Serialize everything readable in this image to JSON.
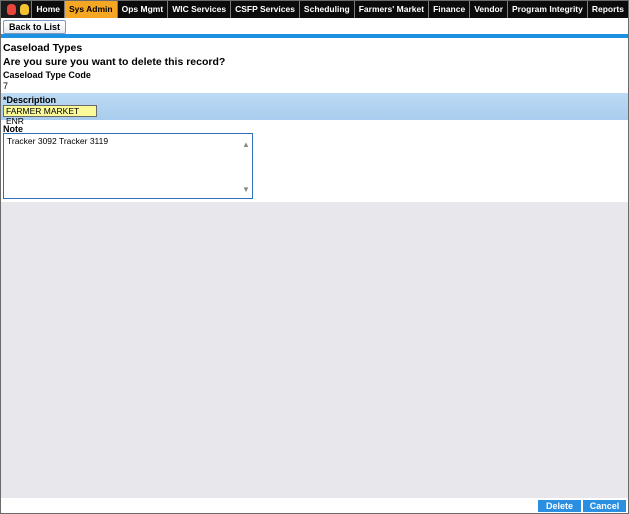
{
  "nav": {
    "items": [
      "Home",
      "Sys Admin",
      "Ops Mgmt",
      "WIC Services",
      "CSFP Services",
      "Scheduling",
      "Farmers' Market",
      "Finance",
      "Vendor",
      "Program Integrity",
      "Reports"
    ],
    "active": "Sys Admin",
    "active_color": "#f5a623"
  },
  "toolbar": {
    "back_label": "Back to List"
  },
  "page": {
    "title": "Caseload Types",
    "confirm": "Are you sure you want to delete this record?"
  },
  "fields": {
    "code_label": "Caseload Type Code",
    "code_value": "7",
    "description_label": "*Description",
    "description_value": "FARMER MARKET ENR",
    "note_label": "Note",
    "note_value": "Tracker 3092 Tracker 3119"
  },
  "footer": {
    "delete_label": "Delete",
    "cancel_label": "Cancel"
  },
  "colors": {
    "accent": "#1e90e0",
    "button": "#2a8fe0",
    "field_highlight": "#fafa9a"
  }
}
